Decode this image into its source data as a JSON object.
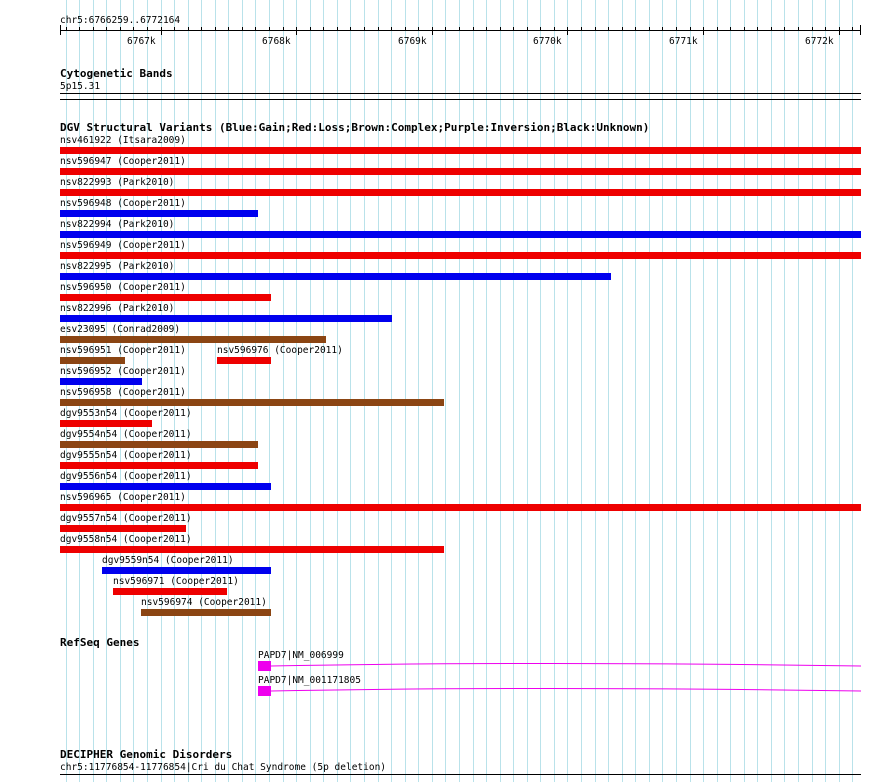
{
  "region": {
    "label": "chr5:6766259..6772164",
    "start": 6766259,
    "end": 6772164
  },
  "ruler": {
    "major": [
      {
        "pos": 6767000,
        "label": "6767k"
      },
      {
        "pos": 6768000,
        "label": "6768k"
      },
      {
        "pos": 6769000,
        "label": "6769k"
      },
      {
        "pos": 6770000,
        "label": "6770k"
      },
      {
        "pos": 6771000,
        "label": "6771k"
      },
      {
        "pos": 6772000,
        "label": "6772k"
      }
    ],
    "minor_step": 100
  },
  "cytobands": {
    "title": "Cytogenetic Bands",
    "band": "5p15.31"
  },
  "dgv": {
    "title": "DGV Structural Variants (Blue:Gain;Red:Loss;Brown:Complex;Purple:Inversion;Black:Unknown)",
    "colors": {
      "Gain": "#0000ee",
      "Loss": "#ee0000",
      "Complex": "#8b4513"
    },
    "variants": [
      {
        "name": "nsv461922 (Itsara2009)",
        "type": "Loss",
        "start": 6766259,
        "end": 6772164,
        "row": 0
      },
      {
        "name": "nsv596947 (Cooper2011)",
        "type": "Loss",
        "start": 6766259,
        "end": 6772164,
        "row": 1
      },
      {
        "name": "nsv822993 (Park2010)",
        "type": "Loss",
        "start": 6766259,
        "end": 6772164,
        "row": 2
      },
      {
        "name": "nsv596948 (Cooper2011)",
        "type": "Gain",
        "start": 6766259,
        "end": 6767720,
        "row": 3
      },
      {
        "name": "nsv822994 (Park2010)",
        "type": "Gain",
        "start": 6766259,
        "end": 6772164,
        "row": 4
      },
      {
        "name": "nsv596949 (Cooper2011)",
        "type": "Loss",
        "start": 6766259,
        "end": 6772164,
        "row": 5
      },
      {
        "name": "nsv822995 (Park2010)",
        "type": "Gain",
        "start": 6766259,
        "end": 6770320,
        "row": 6
      },
      {
        "name": "nsv596950 (Cooper2011)",
        "type": "Loss",
        "start": 6766259,
        "end": 6767815,
        "row": 7
      },
      {
        "name": "nsv822996 (Park2010)",
        "type": "Gain",
        "start": 6766259,
        "end": 6768710,
        "row": 8
      },
      {
        "name": "esv23095 (Conrad2009)",
        "type": "Complex",
        "start": 6766259,
        "end": 6768220,
        "row": 9
      },
      {
        "name": "nsv596951 (Cooper2011)",
        "type": "Complex",
        "start": 6766259,
        "end": 6766735,
        "row": 10
      },
      {
        "name": "nsv596976 (Cooper2011)",
        "type": "Loss",
        "start": 6767415,
        "end": 6767815,
        "row": 10
      },
      {
        "name": "nsv596952 (Cooper2011)",
        "type": "Gain",
        "start": 6766259,
        "end": 6766860,
        "row": 11
      },
      {
        "name": "nsv596958 (Cooper2011)",
        "type": "Complex",
        "start": 6766259,
        "end": 6769090,
        "row": 12
      },
      {
        "name": "dgv9553n54 (Cooper2011)",
        "type": "Loss",
        "start": 6766259,
        "end": 6766940,
        "row": 13
      },
      {
        "name": "dgv9554n54 (Cooper2011)",
        "type": "Complex",
        "start": 6766259,
        "end": 6767720,
        "row": 14
      },
      {
        "name": "dgv9555n54 (Cooper2011)",
        "type": "Loss",
        "start": 6766259,
        "end": 6767720,
        "row": 15
      },
      {
        "name": "dgv9556n54 (Cooper2011)",
        "type": "Gain",
        "start": 6766259,
        "end": 6767815,
        "row": 16
      },
      {
        "name": "nsv596965 (Cooper2011)",
        "type": "Loss",
        "start": 6766259,
        "end": 6772164,
        "row": 17
      },
      {
        "name": "dgv9557n54 (Cooper2011)",
        "type": "Loss",
        "start": 6766259,
        "end": 6767190,
        "row": 18
      },
      {
        "name": "dgv9558n54 (Cooper2011)",
        "type": "Loss",
        "start": 6766259,
        "end": 6769090,
        "row": 19
      },
      {
        "name": "dgv9559n54 (Cooper2011)",
        "type": "Gain",
        "start": 6766570,
        "end": 6767815,
        "row": 20
      },
      {
        "name": "nsv596971 (Cooper2011)",
        "type": "Loss",
        "start": 6766650,
        "end": 6767490,
        "row": 21
      },
      {
        "name": "nsv596974 (Cooper2011)",
        "type": "Complex",
        "start": 6766855,
        "end": 6767815,
        "row": 22
      }
    ]
  },
  "refseq": {
    "title": "RefSeq Genes",
    "color": "#ee00ee",
    "genes": [
      {
        "name": "PAPD7|NM_006999",
        "start": 6767720,
        "exon_end": 6767815,
        "end": 6772164
      },
      {
        "name": "PAPD7|NM_001171805",
        "start": 6767720,
        "exon_end": 6767815,
        "end": 6772164
      }
    ]
  },
  "decipher": {
    "title": "DECIPHER Genomic Disorders",
    "entry": "chr5:11776854-11776854|Cri du Chat Syndrome (5p deletion)"
  }
}
